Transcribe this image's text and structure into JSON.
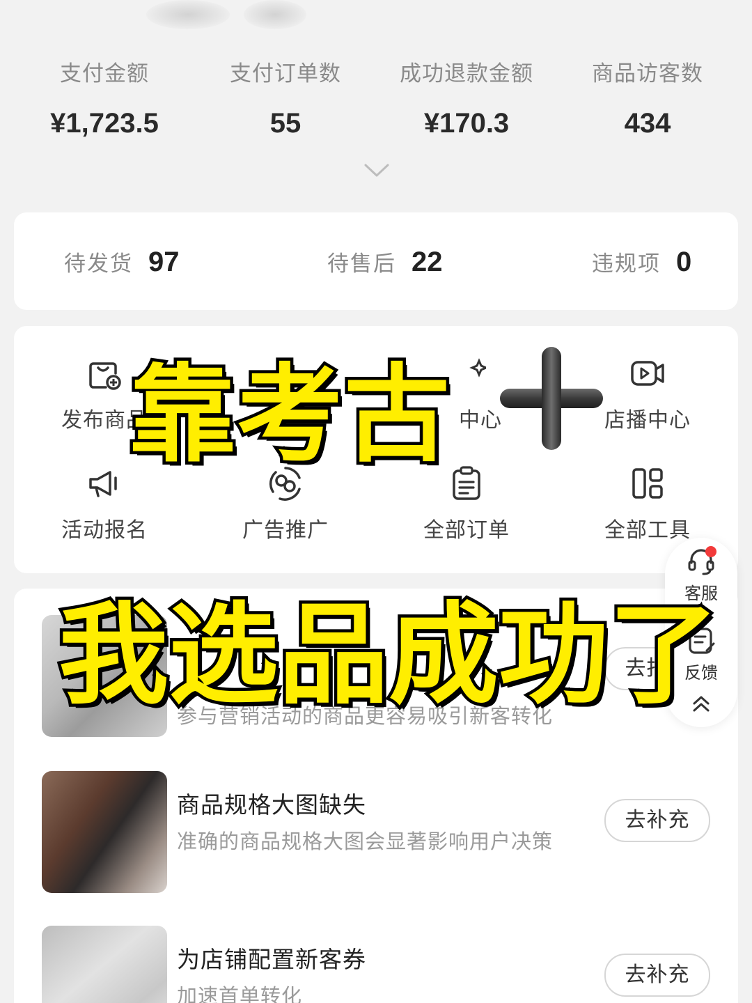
{
  "stats": [
    {
      "label": "支付金额",
      "value": "¥1,723.5"
    },
    {
      "label": "支付订单数",
      "value": "55"
    },
    {
      "label": "成功退款金额",
      "value": "¥170.3"
    },
    {
      "label": "商品访客数",
      "value": "434"
    }
  ],
  "pending": [
    {
      "label": "待发货",
      "value": "97"
    },
    {
      "label": "待售后",
      "value": "22"
    },
    {
      "label": "违规项",
      "value": "0"
    }
  ],
  "tools": [
    {
      "label": "发布商品",
      "icon": "publish-product-icon"
    },
    {
      "label": "中心",
      "icon": "sparkle-center-icon"
    },
    {
      "label": "店播中心",
      "icon": "live-stream-icon"
    },
    {
      "label": "活动报名",
      "icon": "megaphone-icon"
    },
    {
      "label": "广告推广",
      "icon": "promotion-icon"
    },
    {
      "label": "全部订单",
      "icon": "order-list-icon"
    },
    {
      "label": "全部工具",
      "icon": "all-tools-icon"
    }
  ],
  "tasks": [
    {
      "title": "",
      "desc": "参与营销活动的商品更容易吸引新客转化",
      "action": "去报名"
    },
    {
      "title": "商品规格大图缺失",
      "desc": "准确的商品规格大图会显著影响用户决策",
      "action": "去补充"
    },
    {
      "title": "为店铺配置新客券",
      "desc": "加速首单转化",
      "action": "去补充"
    }
  ],
  "float": {
    "service_label": "客服",
    "feedback_label": "反馈"
  },
  "overlay": {
    "line1": "靠考古",
    "line2": "我选品成功了"
  },
  "colors": {
    "overlay_fill": "#ffee00",
    "overlay_stroke": "#000000",
    "background": "#f2f2f2",
    "card": "#ffffff",
    "badge": "#f23a3a"
  }
}
